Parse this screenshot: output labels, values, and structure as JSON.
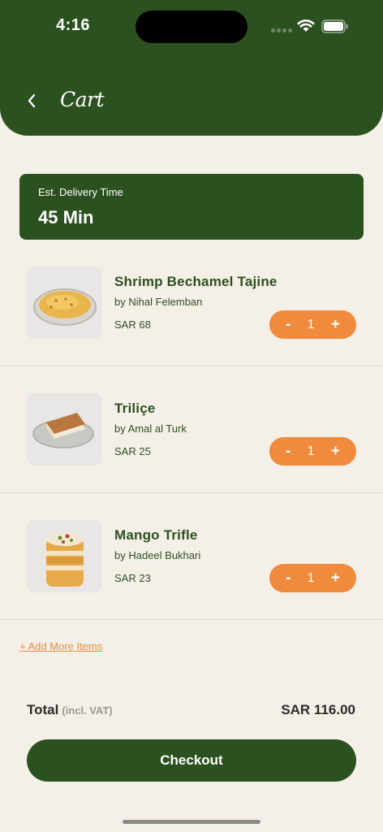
{
  "status_bar": {
    "time": "4:16"
  },
  "header": {
    "title": "Cart"
  },
  "delivery": {
    "label": "Est. Delivery Time",
    "value": "45 Min"
  },
  "items": [
    {
      "name": "Shrimp Bechamel Tajine",
      "vendor": "by Nihal Felemban",
      "price": "SAR 68",
      "qty": "1",
      "minus": "-",
      "plus": "+"
    },
    {
      "name": "Triliçe",
      "vendor": "by Amal al Turk",
      "price": "SAR 25",
      "qty": "1",
      "minus": "-",
      "plus": "+"
    },
    {
      "name": "Mango Trifle",
      "vendor": "by Hadeel Bukhari",
      "price": "SAR 23",
      "qty": "1",
      "minus": "-",
      "plus": "+"
    }
  ],
  "add_more": "+ Add More Items",
  "total": {
    "label": "Total",
    "note": "(incl. VAT)",
    "value": "SAR 116.00"
  },
  "checkout_label": "Checkout",
  "colors": {
    "primary": "#2C5120",
    "accent": "#F08A3C",
    "background": "#F4F0E7"
  }
}
